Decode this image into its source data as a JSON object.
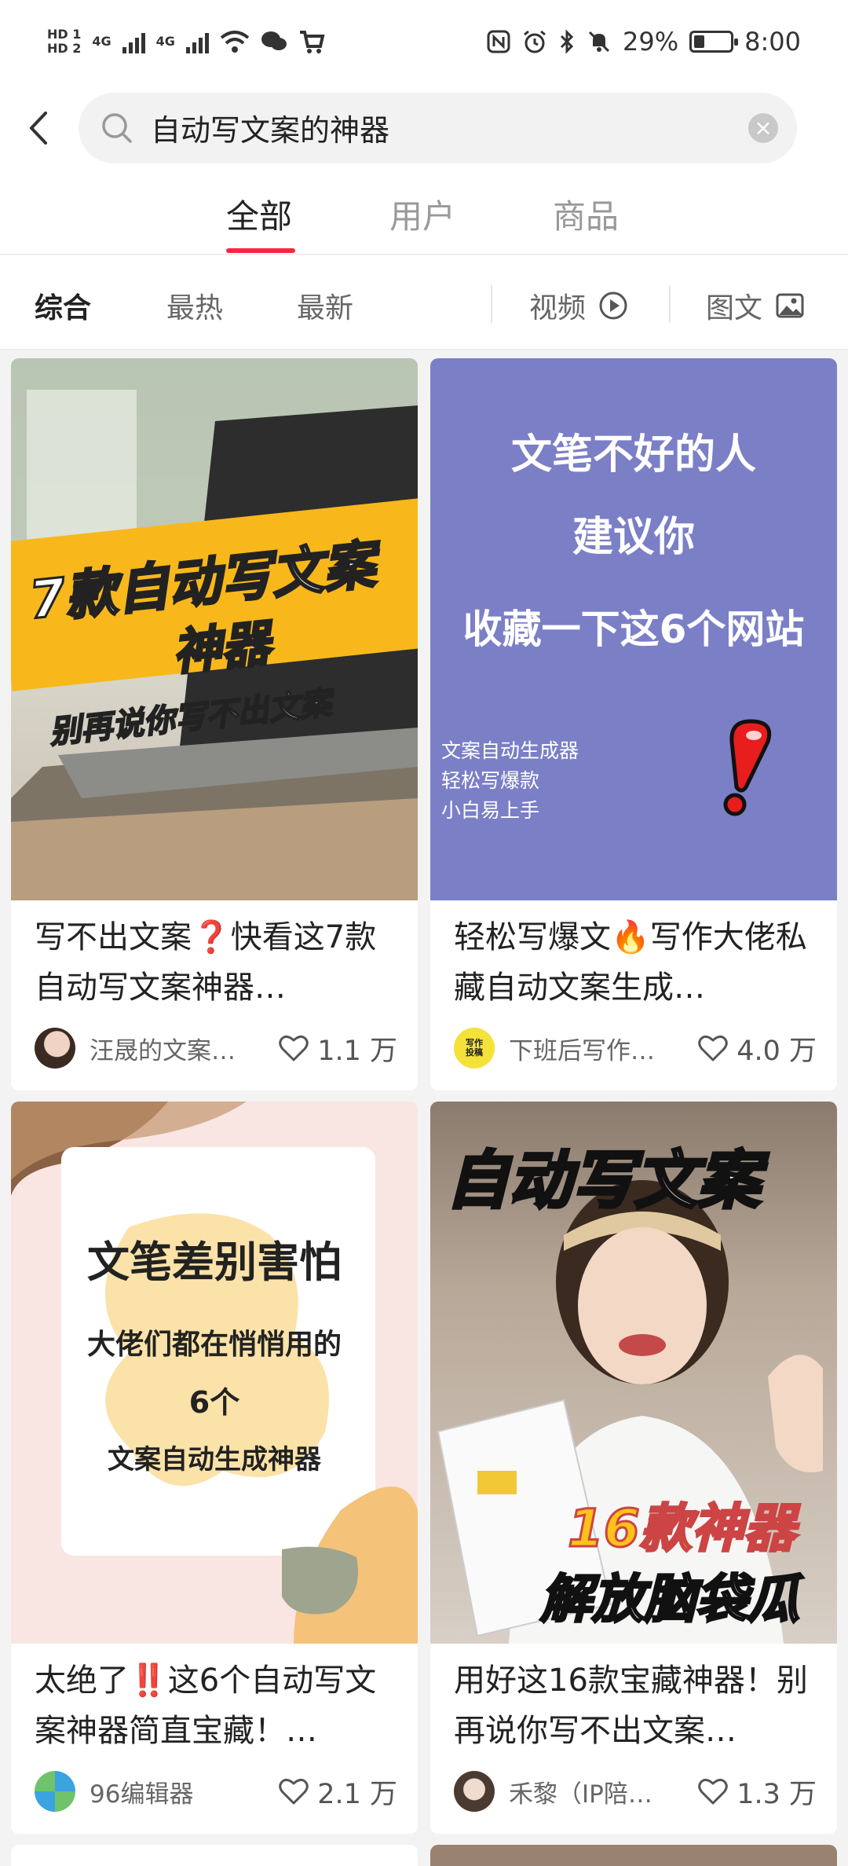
{
  "status_bar": {
    "hd1": "HD 1",
    "hd2": "HD 2",
    "net1": "4G",
    "net2": "4G",
    "battery_percent": "29%",
    "time": "8:00",
    "icons": [
      "signal-icon",
      "wifi-icon",
      "chat-icon",
      "cart-icon",
      "nfc-icon",
      "alarm-icon",
      "bluetooth-icon",
      "mute-icon",
      "battery-icon"
    ]
  },
  "search": {
    "query": "自动写文案的神器",
    "clear": "×"
  },
  "tabs": [
    {
      "label": "全部",
      "active": true
    },
    {
      "label": "用户",
      "active": false
    },
    {
      "label": "商品",
      "active": false
    }
  ],
  "filters": {
    "sort": [
      "综合",
      "最热",
      "最新"
    ],
    "video": "视频",
    "image_text": "图文"
  },
  "accent_color": "#ff2442",
  "cards": [
    {
      "title": "写不出文案❓快看这7款自动写文案神器…",
      "author": "汪晟的文案…",
      "likes": "1.1 万",
      "cover": {
        "banner_line1": "7款自动写文案",
        "banner_line2": "神器",
        "banner_sub": "别再说你写不出文案"
      }
    },
    {
      "title": "轻松写爆文🔥写作大佬私藏自动文案生成…",
      "author": "下班后写作…",
      "likes": "4.0 万",
      "avatar_text": "写作投稿",
      "cover": {
        "line1": "文笔不好的人",
        "line2": "建议你",
        "line3": "收藏一下这6个网站",
        "small1": "文案自动生成器",
        "small2": "轻松写爆款",
        "small3": "小白易上手",
        "bg": "#7b7fc6"
      }
    },
    {
      "title": "太绝了‼️这6个自动写文案神器简直宝藏！…",
      "author": "96编辑器",
      "likes": "2.1 万",
      "cover": {
        "line1": "文笔差别害怕",
        "line2": "大佬们都在悄悄用的",
        "line3": "6个",
        "line4": "文案自动生成神器"
      }
    },
    {
      "title": "用好这16款宝藏神器！别再说你写不出文案…",
      "author": "禾黎（IP陪…",
      "likes": "1.3 万",
      "cover": {
        "top": "自动写文案",
        "bottom1": "16款神器",
        "bottom2": "解放脑袋瓜"
      }
    }
  ]
}
